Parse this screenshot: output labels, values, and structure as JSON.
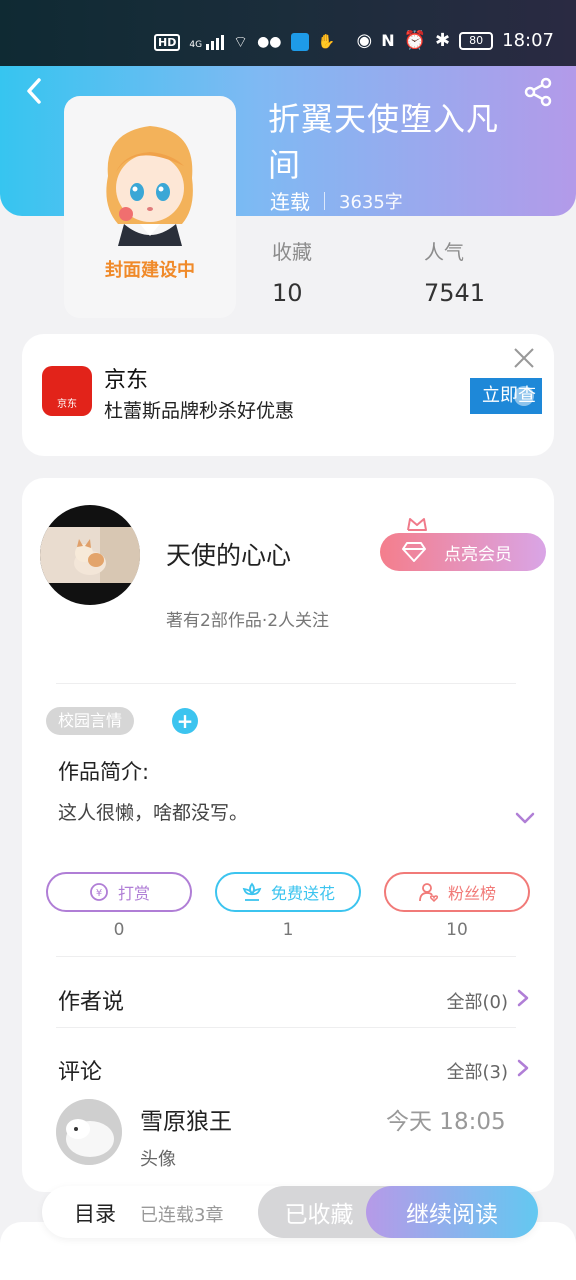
{
  "status_bar": {
    "network_badge": "HD",
    "signal_label": "4G",
    "battery": "80",
    "time": "18:07"
  },
  "header": {
    "title": "折翼天使堕入凡间",
    "status": "连载",
    "word_count": "3635字",
    "cover_label": "封面建设中",
    "stats": [
      {
        "label": "收藏",
        "value": "10"
      },
      {
        "label": "人气",
        "value": "7541"
      }
    ]
  },
  "ad": {
    "brand_logo_text": "京东",
    "name": "京东",
    "description": "杜蕾斯品牌秒杀好优惠",
    "button_label": "立即查"
  },
  "author": {
    "name": "天使的心心",
    "summary": "著有2部作品·2人关注",
    "vip_label": "点亮会员"
  },
  "tags": [
    "校园言情"
  ],
  "intro": {
    "heading": "作品简介:",
    "text": "这人很懒，啥都没写。"
  },
  "actions": [
    {
      "label": "打赏",
      "count": "0",
      "color": "#b07ed6",
      "icon": "yen-coin-icon"
    },
    {
      "label": "免费送花",
      "count": "1",
      "color": "#3cc4ef",
      "icon": "flower-icon"
    },
    {
      "label": "粉丝榜",
      "count": "10",
      "color": "#f17a78",
      "icon": "fan-person-icon"
    }
  ],
  "author_says": {
    "title": "作者说",
    "link": "全部(0)"
  },
  "comments": {
    "title": "评论",
    "link": "全部(3)",
    "items": [
      {
        "user": "雪原狼王",
        "time": "今天 18:05",
        "text": "头像"
      }
    ]
  },
  "bottom_bar": {
    "toc_label": "目录",
    "toc_sub": "已连载3章",
    "favorite_label": "已收藏",
    "read_label": "继续阅读"
  },
  "colors": {
    "accent_blue": "#36c5f0",
    "accent_purple": "#b39ae9",
    "vip_pink": "#f47e8c"
  }
}
